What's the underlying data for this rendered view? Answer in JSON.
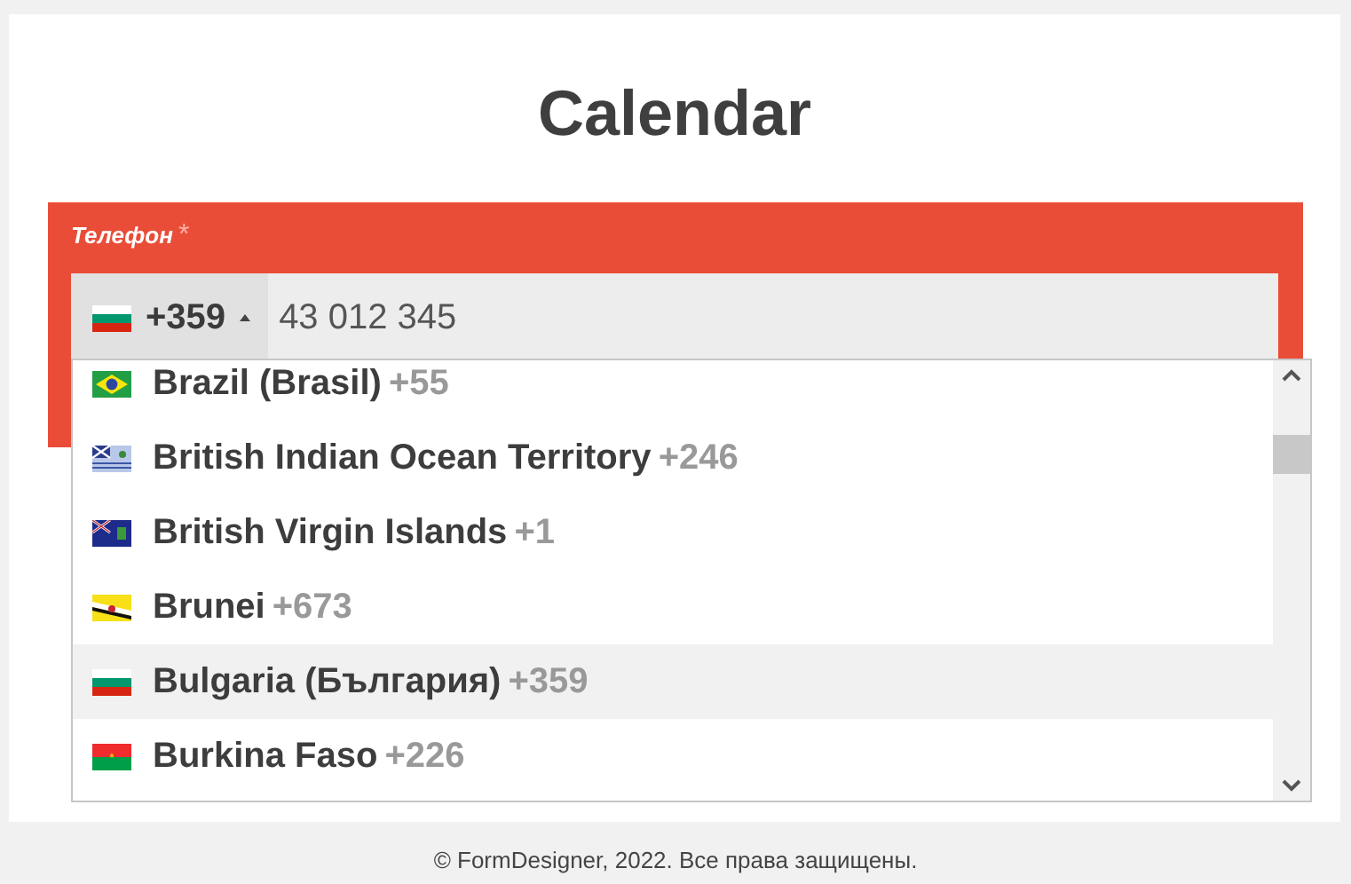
{
  "title": "Calendar",
  "phone": {
    "label": "Телефон",
    "required_mark": "*",
    "dial_code": "+359",
    "value": "43 012 345",
    "expanded": true
  },
  "countries": [
    {
      "name": "Brazil (Brasil)",
      "code": "+55",
      "selected": false
    },
    {
      "name": "British Indian Ocean Territory",
      "code": "+246",
      "selected": false
    },
    {
      "name": "British Virgin Islands",
      "code": "+1",
      "selected": false
    },
    {
      "name": "Brunei",
      "code": "+673",
      "selected": false
    },
    {
      "name": "Bulgaria (България)",
      "code": "+359",
      "selected": true
    },
    {
      "name": "Burkina Faso",
      "code": "+226",
      "selected": false
    }
  ],
  "footer": "© FormDesigner, 2022. Все права защищены."
}
